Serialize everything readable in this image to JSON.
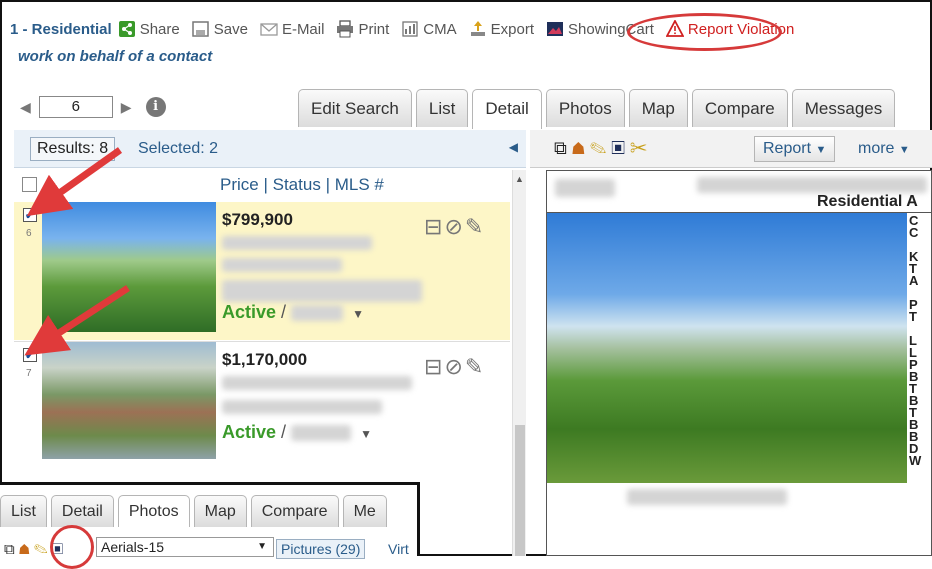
{
  "toolbar": {
    "title": "1 - Residential",
    "share": "Share",
    "save": "Save",
    "email": "E-Mail",
    "print": "Print",
    "cma": "CMA",
    "export": "Export",
    "showing_cart": "ShowingCart",
    "report_violation": "Report Violation"
  },
  "subtitle": "work on behalf of a contact",
  "pager": {
    "page": "6",
    "info": "i"
  },
  "tabs": [
    "Edit Search",
    "List",
    "Detail",
    "Photos",
    "Map",
    "Compare",
    "Messages"
  ],
  "results": {
    "button": "Results: 8",
    "selected": "Selected: 2"
  },
  "list_header": {
    "price": "Price",
    "status": "Status",
    "mls": "MLS #",
    "sep": "|"
  },
  "rows": [
    {
      "num": "6",
      "price": "$799,900",
      "status": "Active",
      "checked": "✔"
    },
    {
      "num": "7",
      "price": "$1,170,000",
      "status": "Active",
      "checked": "✔"
    }
  ],
  "right": {
    "report": "Report",
    "more": "more",
    "residential_label": "Residential A"
  },
  "right_letters": "C\nC\n\nK\nT\nA\n\nP\nT\n\nL\nL\nP\nB\nT\nB\nT\nB\nB\nD\nW",
  "inset": {
    "tabs": [
      "List",
      "Detail",
      "Photos",
      "Map",
      "Compare",
      "Me"
    ],
    "select": "Aerials-15",
    "pictures": "Pictures (29)",
    "virtual": "Virt"
  },
  "colors": {
    "accent": "#2a5c8a",
    "active_green": "#3a9a2a",
    "annotation_red": "#d63a3a",
    "highlight_row": "#fdf6c7"
  }
}
